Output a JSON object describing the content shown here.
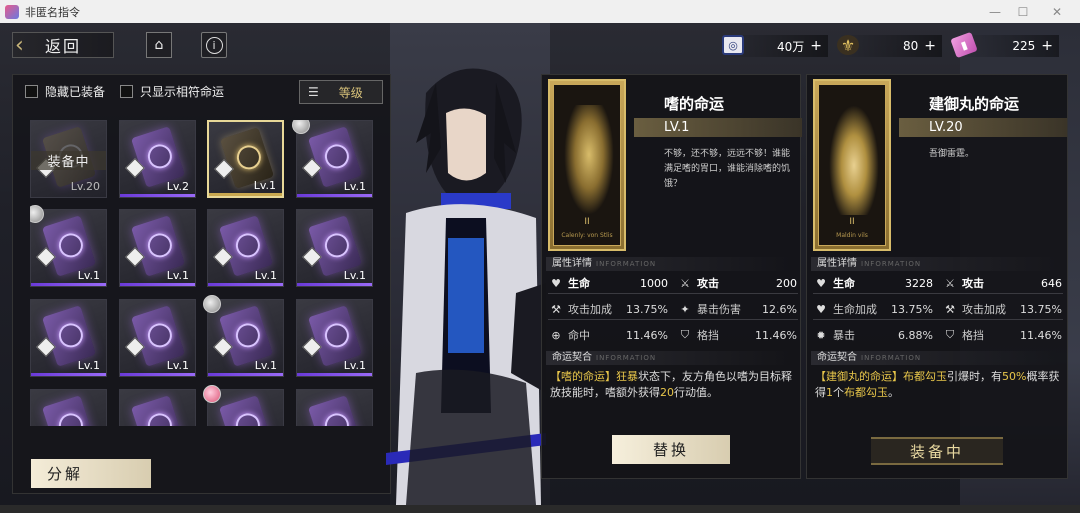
{
  "window": {
    "title": "非匿名指令",
    "min": "—",
    "max": "☐",
    "close": "✕"
  },
  "topbar": {
    "back_label": "返回",
    "resources": [
      {
        "icon": "ring-currency-icon",
        "amount": "40万",
        "plus": "+",
        "color": "#2a3a7a"
      },
      {
        "icon": "fleur-currency-icon",
        "amount": "80",
        "plus": "+",
        "color": "#c9a850"
      },
      {
        "icon": "ticket-currency-icon",
        "amount": "225",
        "plus": "+",
        "color": "#e070c0"
      }
    ]
  },
  "left": {
    "filter_hide_equipped": "隐藏已装备",
    "filter_show_matching": "只显示相符命运",
    "sort_label": "等级",
    "equipped_text": "装备中",
    "cards": [
      {
        "level": "Lv.20",
        "type": "equipped"
      },
      {
        "level": "Lv.2",
        "type": "purple"
      },
      {
        "level": "Lv.1",
        "type": "gold-selected"
      },
      {
        "level": "Lv.1",
        "type": "purple",
        "avatar": true
      },
      {
        "level": "Lv.1",
        "type": "purple",
        "avatar": true
      },
      {
        "level": "Lv.1",
        "type": "purple"
      },
      {
        "level": "Lv.1",
        "type": "purple"
      },
      {
        "level": "Lv.1",
        "type": "purple"
      },
      {
        "level": "Lv.1",
        "type": "purple"
      },
      {
        "level": "Lv.1",
        "type": "purple"
      },
      {
        "level": "Lv.1",
        "type": "purple",
        "avatar": true
      },
      {
        "level": "Lv.1",
        "type": "purple"
      },
      {
        "level": "",
        "type": "purple"
      },
      {
        "level": "",
        "type": "purple"
      },
      {
        "level": "",
        "type": "purple",
        "avatar": "pink"
      },
      {
        "level": "",
        "type": "purple"
      }
    ],
    "decompose_label": "分解"
  },
  "fate1": {
    "name": "嗜的命运",
    "level": "LV.1",
    "roman": "II",
    "caption": "Calenly: von Stlis",
    "desc": "不够，还不够，远远不够！谁能满足嗜的胃口，谁能消除嗜的饥饿？",
    "sect_stats": "属性详情",
    "sect_en": "INFORMATION",
    "stats": [
      {
        "label": "生命",
        "value": "1000",
        "icon": "heart-icon",
        "hl": true
      },
      {
        "label": "攻击",
        "value": "200",
        "icon": "sword-icon",
        "hl": true
      },
      {
        "label": "攻击加成",
        "value": "13.75%",
        "icon": "attack-bonus-icon",
        "hl": false
      },
      {
        "label": "暴击伤害",
        "value": "12.6%",
        "icon": "crit-damage-icon",
        "hl": false
      },
      {
        "label": "命中",
        "value": "11.46%",
        "icon": "target-icon",
        "hl": false
      },
      {
        "label": "格挡",
        "value": "11.46%",
        "icon": "shield-icon",
        "hl": false
      }
    ],
    "sect_skill": "命运契合",
    "skill_name": "【嗜的命运】",
    "skill_kw": "狂暴",
    "skill_text1": "状态下，友方角色以嗜为目标释放技能时，嗜额外获得",
    "skill_num": "20",
    "skill_text2": "行动值。",
    "button": "替换"
  },
  "fate2": {
    "name": "建御丸的命运",
    "level": "LV.20",
    "roman": "II",
    "caption": "Maldin vils",
    "desc": "吾御雷霆。",
    "sect_stats": "属性详情",
    "sect_en": "INFORMATION",
    "stats": [
      {
        "label": "生命",
        "value": "3228",
        "icon": "heart-icon",
        "hl": true
      },
      {
        "label": "攻击",
        "value": "646",
        "icon": "sword-icon",
        "hl": true
      },
      {
        "label": "生命加成",
        "value": "13.75%",
        "icon": "hp-bonus-icon",
        "hl": false
      },
      {
        "label": "攻击加成",
        "value": "13.75%",
        "icon": "attack-bonus-icon",
        "hl": false
      },
      {
        "label": "暴击",
        "value": "6.88%",
        "icon": "crit-icon",
        "hl": false
      },
      {
        "label": "格挡",
        "value": "11.46%",
        "icon": "shield-icon",
        "hl": false
      }
    ],
    "sect_skill": "命运契合",
    "skill_name": "【建御丸的命运】",
    "skill_kw": "布都勾玉",
    "skill_text1": "引爆时，有",
    "skill_pct": "50%",
    "skill_text2": "概率获得",
    "skill_num": "1",
    "skill_text3": "个",
    "skill_kw2": "布都勾玉",
    "skill_text4": "。",
    "button": "装备中"
  }
}
